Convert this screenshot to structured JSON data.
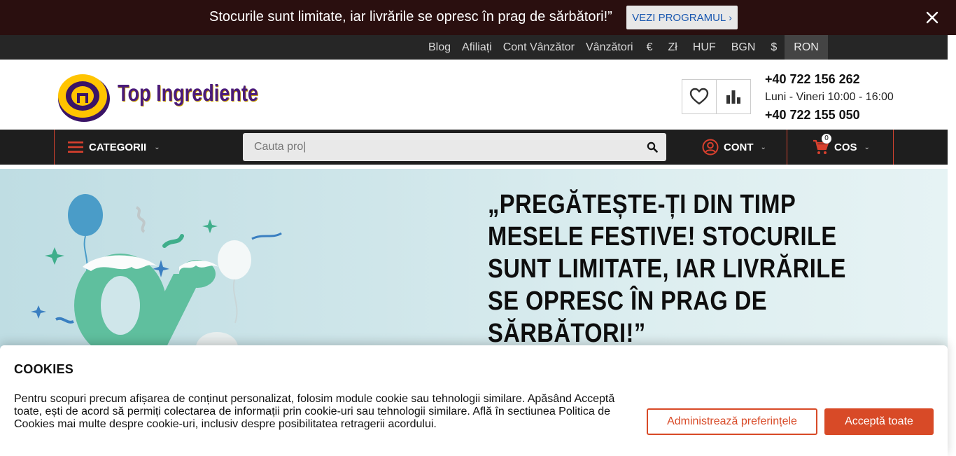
{
  "announcement": {
    "text": "Stocurile sunt limitate, iar livrările se opresc în prag de sărbători!”",
    "button_label": "VEZI PROGRAMUL",
    "button_icon": "chevron-right-icon",
    "close_icon": "close-icon"
  },
  "topbar": {
    "links": [
      "Blog",
      "Afiliați",
      "Cont Vânzător",
      "Vânzători"
    ],
    "currencies": [
      "€",
      "Zł",
      "HUF",
      "BGN",
      "$",
      "RON"
    ],
    "active_currency": "RON"
  },
  "header": {
    "logo_text": "Top Ingrediente",
    "phone1": "+40 722 156 262",
    "hours": "Luni - Vineri 10:00 - 16:00",
    "phone2": "+40 722 155 050"
  },
  "nav": {
    "categories_label": "CATEGORII",
    "search_placeholder": "Cauta pro|",
    "account_label": "CONT",
    "cart_label": "COS",
    "cart_count": "0"
  },
  "hero": {
    "title": "„Pregătește-ți din timp mesele festive! Stocurile sunt limitate, iar livrările se opresc în prag de sărbători!”"
  },
  "cookies": {
    "title": "COOKIES",
    "text": "Pentru scopuri precum afișarea de conținut personalizat, folosim module cookie sau tehnologii similare. Apăsând Acceptă toate, ești de acord să permiți colectarea de informații prin cookie-uri sau tehnologii similare. Află în sectiunea Politica de Cookies mai multe despre cookie-uri, inclusiv despre posibilitatea retragerii acordului.",
    "prefs_label": "Administrează preferințele",
    "accept_label": "Acceptă toate"
  },
  "colors": {
    "announce_bg": "#2a0f0f",
    "topbar_bg": "#262626",
    "navbar_bg": "#1e1e1e",
    "accent": "#d84a27",
    "logo_purple": "#4a1a7a"
  }
}
